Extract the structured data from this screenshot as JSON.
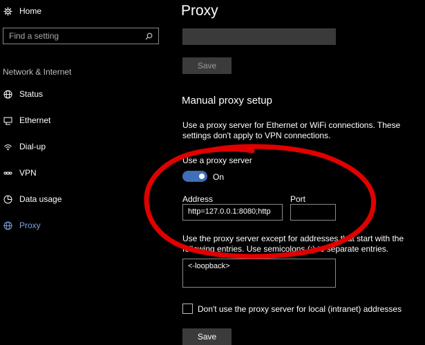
{
  "sidebar": {
    "home_label": "Home",
    "search_placeholder": "Find a setting",
    "section_label": "Network & Internet",
    "items": [
      {
        "label": "Status",
        "icon": "globe-icon"
      },
      {
        "label": "Ethernet",
        "icon": "ethernet-icon"
      },
      {
        "label": "Dial-up",
        "icon": "dialup-icon"
      },
      {
        "label": "VPN",
        "icon": "vpn-icon"
      },
      {
        "label": "Data usage",
        "icon": "data-usage-icon"
      },
      {
        "label": "Proxy",
        "icon": "proxy-globe-icon"
      }
    ]
  },
  "main": {
    "title": "Proxy",
    "save_label": "Save",
    "manual_heading": "Manual proxy setup",
    "manual_description": "Use a proxy server for Ethernet or WiFi connections. These settings don't apply to VPN connections.",
    "use_proxy_label": "Use a proxy server",
    "toggle_state": "On",
    "address_label": "Address",
    "address_value": "http=127.0.0.1:8080;http",
    "port_label": "Port",
    "port_value": "",
    "exceptions_description": "Use the proxy server except for addresses that start with the following entries. Use semicolons (;) to separate entries.",
    "exceptions_value": "<-loopback>",
    "local_checkbox_label": "Don't use the proxy server for local (intranet) addresses",
    "save2_label": "Save"
  },
  "colors": {
    "accent": "#3e6fb8",
    "active_nav": "#7aa6e6",
    "annotation": "#e00000"
  }
}
